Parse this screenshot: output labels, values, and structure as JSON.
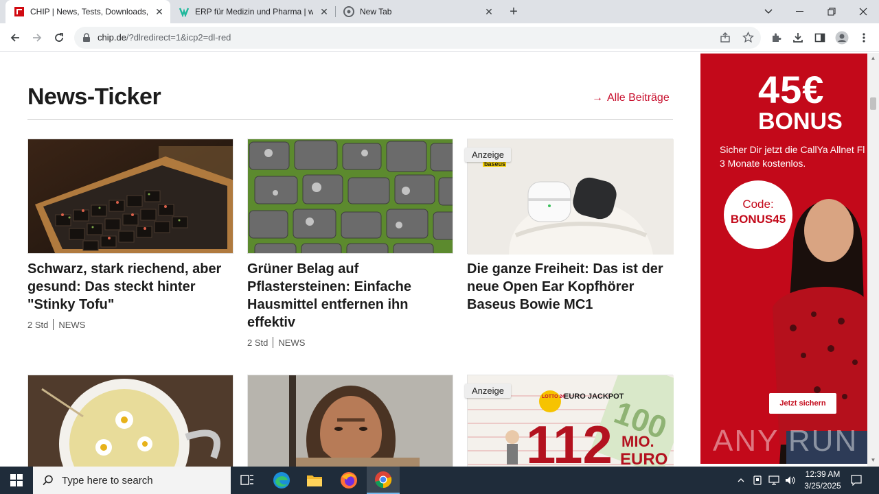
{
  "browser": {
    "tabs": [
      {
        "title": "CHIP | News, Tests, Downloads, T",
        "favicon": "chip-favicon",
        "active": true
      },
      {
        "title": "ERP für Medizin und Pharma | w",
        "favicon": "erp-favicon",
        "active": false
      },
      {
        "title": "New Tab",
        "favicon": "chrome-favicon",
        "active": false
      }
    ],
    "address": {
      "domain": "chip.de",
      "path": "/?dlredirect=1&icp2=dl-red"
    }
  },
  "page": {
    "section_title": "News-Ticker",
    "all_posts_label": "Alle Beiträge",
    "accent_color": "#c8102e",
    "cards": [
      {
        "title": "Schwarz, stark riechend, aber gesund: Das steckt hinter \"Stinky Tofu\"",
        "time": "2 Std",
        "category": "NEWS",
        "image": "stinky-tofu-image",
        "ad": false
      },
      {
        "title": "Grüner Belag auf Pflastersteinen: Einfache Hausmittel entfernen ihn effektiv",
        "time": "2 Std",
        "category": "NEWS",
        "image": "paving-stones-image",
        "ad": false
      },
      {
        "title": "Die ganze Freiheit: Das ist der neue Open Ear Kopfhörer Baseus Bowie MC1",
        "badge": "Anzeige",
        "image": "earbuds-image",
        "brand": "baseus",
        "ad": true
      }
    ],
    "row2": [
      {
        "image": "chamomile-tea-image",
        "ad": false
      },
      {
        "image": "neanderthal-image",
        "ad": false
      },
      {
        "image": "lotto-image",
        "badge": "Anzeige",
        "ad": true,
        "lotto_brand": "LOTTO 24",
        "lotto_label": "EURO JACKPOT",
        "amount": "112",
        "unit_line1": "MIO.",
        "unit_line2": "EURO"
      }
    ]
  },
  "ad_banner": {
    "amount": "45€",
    "bonus": "BONUS",
    "text_line1": "Sicher Dir jetzt die CallYa Allnet Fl",
    "text_line2": "3 Monate kostenlos.",
    "code_label": "Code:",
    "code_value": "BONUS45",
    "cta": "Jetzt sichern",
    "watermark": "ANY RUN",
    "color": "#c3091a"
  },
  "taskbar": {
    "search_placeholder": "Type here to search",
    "time": "12:39 AM",
    "date": "3/25/2025"
  }
}
